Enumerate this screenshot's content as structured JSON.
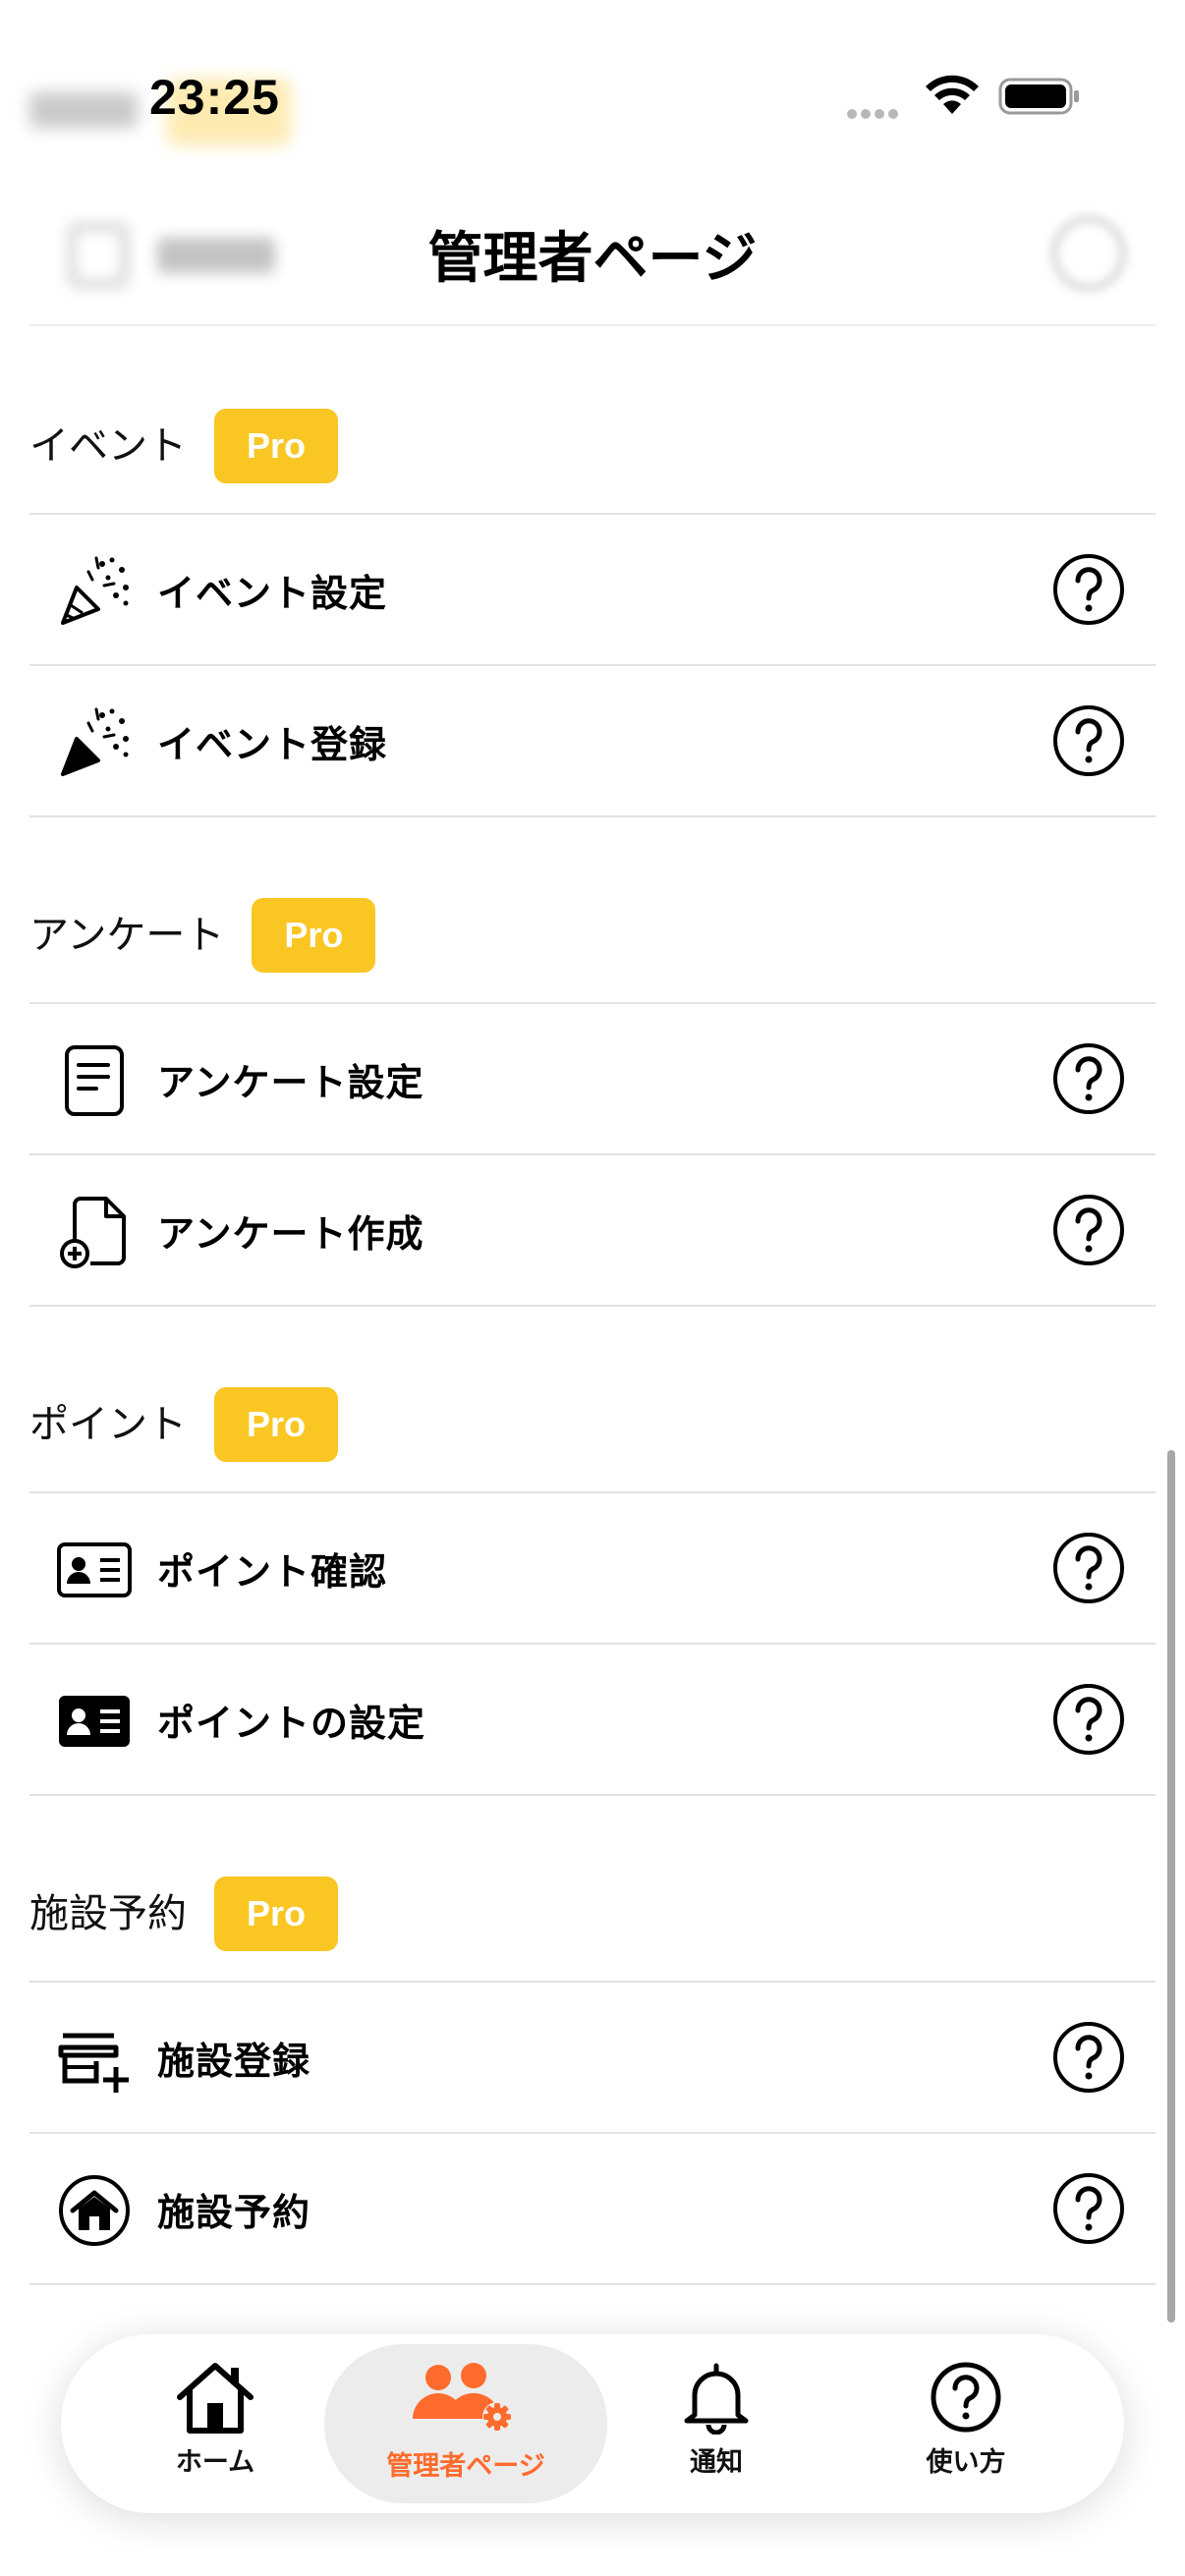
{
  "status": {
    "time": "23:25"
  },
  "header": {
    "title": "管理者ページ"
  },
  "colors": {
    "accent": "#ff6b2c",
    "pro_badge": "#f9c623"
  },
  "sections": [
    {
      "title": "イベント",
      "badge": "Pro",
      "items": [
        {
          "label": "イベント設定",
          "icon": "party-popper-outline-icon"
        },
        {
          "label": "イベント登録",
          "icon": "party-popper-filled-icon"
        }
      ]
    },
    {
      "title": "アンケート",
      "badge": "Pro",
      "items": [
        {
          "label": "アンケート設定",
          "icon": "document-icon"
        },
        {
          "label": "アンケート作成",
          "icon": "document-add-icon"
        }
      ]
    },
    {
      "title": "ポイント",
      "badge": "Pro",
      "items": [
        {
          "label": "ポイント確認",
          "icon": "id-card-outline-icon"
        },
        {
          "label": "ポイントの設定",
          "icon": "id-card-filled-icon"
        }
      ]
    },
    {
      "title": "施設予約",
      "badge": "Pro",
      "items": [
        {
          "label": "施設登録",
          "icon": "store-add-icon"
        },
        {
          "label": "施設予約",
          "icon": "home-circle-icon"
        }
      ]
    }
  ],
  "tabs": [
    {
      "label": "ホーム",
      "icon": "home-icon"
    },
    {
      "label": "管理者ページ",
      "icon": "users-gear-icon",
      "active": true
    },
    {
      "label": "通知",
      "icon": "bell-icon"
    },
    {
      "label": "使い方",
      "icon": "help-circle-icon"
    }
  ]
}
